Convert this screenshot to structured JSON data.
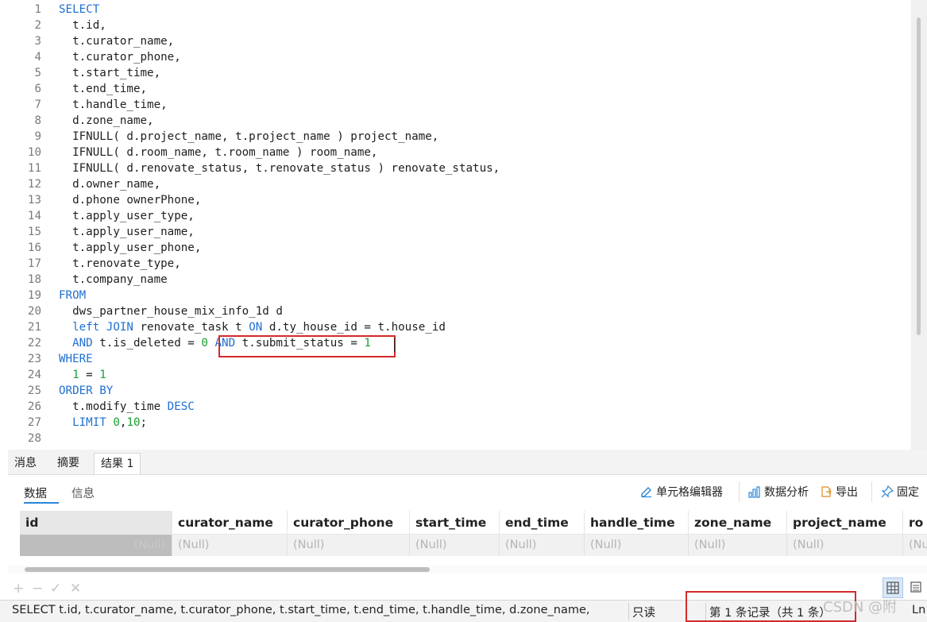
{
  "editor": {
    "lines": [
      [
        {
          "t": "SELECT",
          "c": "kw"
        }
      ],
      [
        {
          "t": "  t.id,"
        }
      ],
      [
        {
          "t": "  t.curator_name,"
        }
      ],
      [
        {
          "t": "  t.curator_phone,"
        }
      ],
      [
        {
          "t": "  t.start_time,"
        }
      ],
      [
        {
          "t": "  t.end_time,"
        }
      ],
      [
        {
          "t": "  t.handle_time,"
        }
      ],
      [
        {
          "t": "  d.zone_name,"
        }
      ],
      [
        {
          "t": "  IFNULL( d.project_name, t.project_name ) project_name,"
        }
      ],
      [
        {
          "t": "  IFNULL( d.room_name, t.room_name ) room_name,"
        }
      ],
      [
        {
          "t": "  IFNULL( d.renovate_status, t.renovate_status ) renovate_status,"
        }
      ],
      [
        {
          "t": "  d.owner_name,"
        }
      ],
      [
        {
          "t": "  d.phone ownerPhone,"
        }
      ],
      [
        {
          "t": "  t.apply_user_type,"
        }
      ],
      [
        {
          "t": "  t.apply_user_name,"
        }
      ],
      [
        {
          "t": "  t.apply_user_phone,"
        }
      ],
      [
        {
          "t": "  t.renovate_type,"
        }
      ],
      [
        {
          "t": "  t.company_name"
        }
      ],
      [
        {
          "t": "FROM",
          "c": "kw"
        }
      ],
      [
        {
          "t": "  dws_partner_house_mix_info_1d d"
        }
      ],
      [
        {
          "t": "  "
        },
        {
          "t": "left JOIN",
          "c": "kw"
        },
        {
          "t": " renovate_task t "
        },
        {
          "t": "ON",
          "c": "kw"
        },
        {
          "t": " d.ty_house_id = t.house_id"
        }
      ],
      [
        {
          "t": "  "
        },
        {
          "t": "AND",
          "c": "kw"
        },
        {
          "t": " t.is_deleted = "
        },
        {
          "t": "0",
          "c": "num"
        },
        {
          "t": " "
        },
        {
          "t": "AND",
          "c": "kw"
        },
        {
          "t": " t.submit_status = "
        },
        {
          "t": "1",
          "c": "num"
        }
      ],
      [
        {
          "t": "WHERE",
          "c": "kw"
        }
      ],
      [
        {
          "t": "  "
        },
        {
          "t": "1",
          "c": "num"
        },
        {
          "t": " = "
        },
        {
          "t": "1",
          "c": "num"
        }
      ],
      [
        {
          "t": "ORDER BY",
          "c": "kw"
        }
      ],
      [
        {
          "t": "  t.modify_time "
        },
        {
          "t": "DESC",
          "c": "kw"
        }
      ],
      [
        {
          "t": "  "
        },
        {
          "t": "LIMIT",
          "c": "kw"
        },
        {
          "t": " "
        },
        {
          "t": "0",
          "c": "num"
        },
        {
          "t": ","
        },
        {
          "t": "10",
          "c": "num"
        },
        {
          "t": ";"
        }
      ],
      []
    ]
  },
  "result_tabs": [
    "消息",
    "摘要",
    "结果 1"
  ],
  "sub_tabs": {
    "data": "数据",
    "info": "信息"
  },
  "toolbar": {
    "cell_editor": "单元格编辑器",
    "data_analysis": "数据分析",
    "export": "导出",
    "pin": "固定"
  },
  "grid": {
    "columns": [
      "id",
      "curator_name",
      "curator_phone",
      "start_time",
      "end_time",
      "handle_time",
      "zone_name",
      "project_name",
      "ro"
    ],
    "rows": [
      [
        "(Null)",
        "(Null)",
        "(Null)",
        "(Null)",
        "(Null)",
        "(Null)",
        "(Null)",
        "(Null)",
        "(Nu"
      ]
    ]
  },
  "edit_tools": [
    "+",
    "−",
    "✓",
    "✕"
  ],
  "statusbar": {
    "query": "SELECT   t.id,   t.curator_name,   t.curator_phone,   t.start_time,   t.end_time,   t.handle_time,   d.zone_name,",
    "mode": "只读",
    "records": "第 1 条记录（共 1 条）",
    "position": "Ln"
  },
  "watermark": "CSDN @附"
}
